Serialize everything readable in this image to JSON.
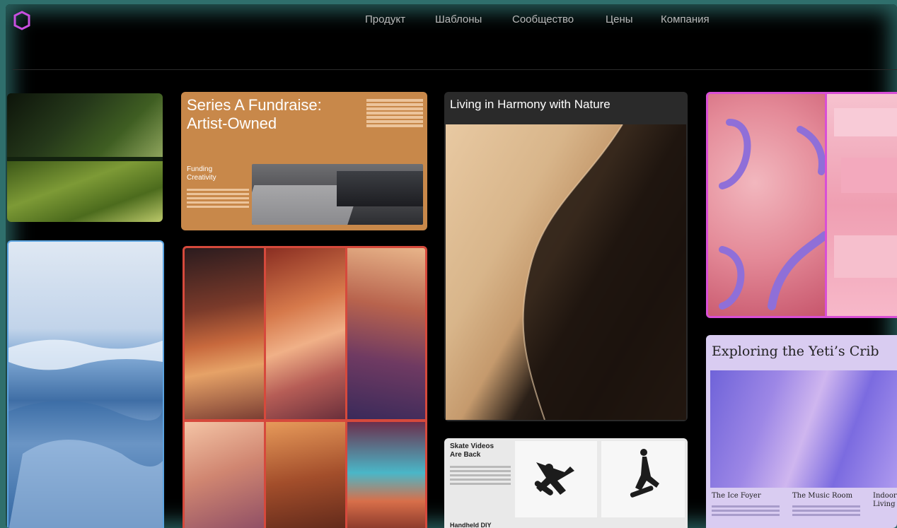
{
  "nav": {
    "items": [
      "Продукт",
      "Шаблоны",
      "Сообщество",
      "Цены",
      "Компания"
    ]
  },
  "cards": {
    "fundraise": {
      "title": "Series A Fundraise: Artist-Owned",
      "subtitle": "Funding Creativity"
    },
    "nature": {
      "title": "Living in Harmony with Nature"
    },
    "skate": {
      "title": "Skate Videos Are Back",
      "subtitle": "Handheld DIY"
    },
    "yeti": {
      "title": "Exploring the Yeti’s Crib",
      "col1": "The Ice Foyer",
      "col2": "The Music Room",
      "col3": "Indoor Living"
    }
  },
  "colors": {
    "accent_pink": "#d94fd6",
    "accent_red": "#d6493c",
    "accent_blue": "#5aa3e0",
    "frame_teal": "#2f6f6c"
  }
}
